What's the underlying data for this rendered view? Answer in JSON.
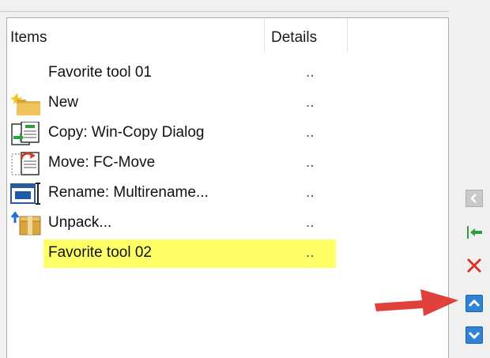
{
  "columns": {
    "items": "Items",
    "details": "Details"
  },
  "rows": [
    {
      "label": "Favorite tool 01",
      "detail": "..",
      "icon": "none",
      "selected": false
    },
    {
      "label": "New",
      "detail": "..",
      "icon": "new-folder-icon",
      "selected": false
    },
    {
      "label": "Copy: Win-Copy Dialog",
      "detail": "..",
      "icon": "copy-icon",
      "selected": false
    },
    {
      "label": "Move: FC-Move",
      "detail": "..",
      "icon": "move-icon",
      "selected": false
    },
    {
      "label": "Rename: Multirename...",
      "detail": "..",
      "icon": "rename-icon",
      "selected": false
    },
    {
      "label": "Unpack...",
      "detail": "..",
      "icon": "unpack-icon",
      "selected": false
    },
    {
      "label": "Favorite tool 02",
      "detail": "..",
      "icon": "none",
      "selected": true
    }
  ],
  "side_buttons": [
    "scroll-left-icon",
    "insert-icon",
    "delete-icon",
    "move-up-icon",
    "move-down-icon"
  ],
  "colors": {
    "highlight": "#ffff66",
    "button_blue": "#2f83d6",
    "annotation_arrow": "#e0413a"
  }
}
